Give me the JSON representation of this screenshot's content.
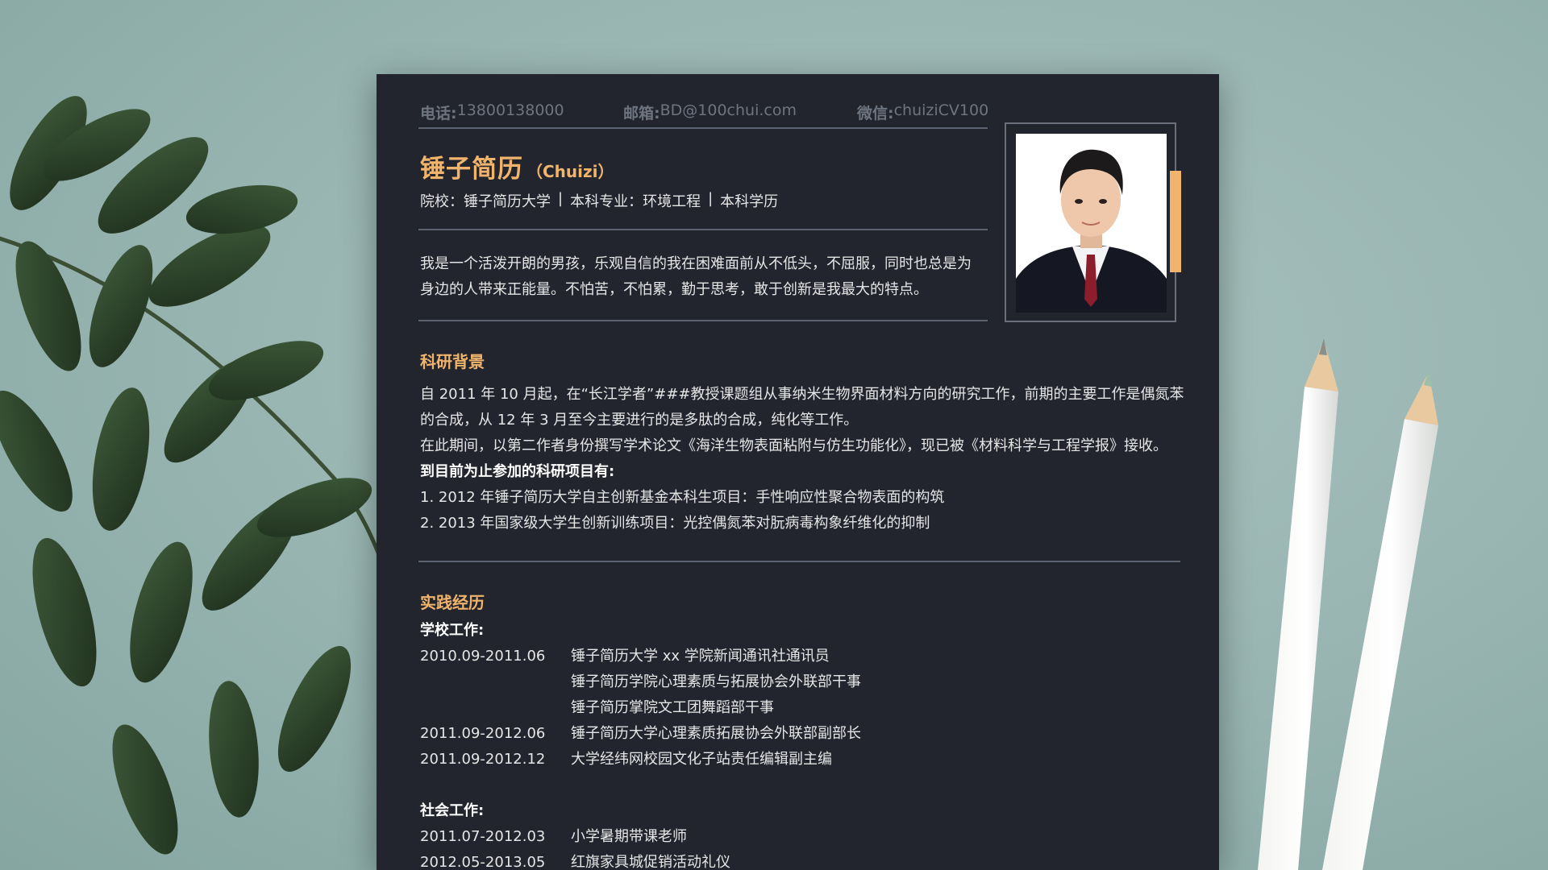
{
  "contact": {
    "phone_label": "电话:",
    "phone": "13800138000",
    "email_label": "邮箱:",
    "email": "BD@100chui.com",
    "wechat_label": "微信:",
    "wechat": "chuiziCV100"
  },
  "profile": {
    "name": "锤子简历",
    "name_en": "（Chuizi）",
    "school": "院校：锤子简历大学",
    "major": "本科专业：环境工程",
    "degree": "本科学历",
    "separator": "|",
    "intro": "我是一个活泼开朗的男孩，乐观自信的我在困难面前从不低头，不屈服，同时也总是为身边的人带来正能量。不怕苦，不怕累，勤于思考，敢于创新是我最大的特点。"
  },
  "research": {
    "title": "科研背景",
    "para1": "自 2011 年 10 月起，在“长江学者”###教授课题组从事纳米生物界面材料方向的研究工作，前期的主要工作是偶氮苯的合成，从 12 年 3 月至今主要进行的是多肽的合成，纯化等工作。",
    "para2": "在此期间，以第二作者身份撰写学术论文《海洋生物表面粘附与仿生功能化》，现已被《材料科学与工程学报》接收。",
    "projects_heading": "到目前为止参加的科研项目有:",
    "projects": [
      "1.  2012 年锤子简历大学自主创新基金本科生项目：手性响应性聚合物表面的构筑",
      "2.  2013 年国家级大学生创新训练项目：光控偶氮苯对朊病毒构象纤维化的抑制"
    ]
  },
  "practice": {
    "title": "实践经历",
    "school_heading": "学校工作:",
    "school_rows": [
      {
        "date": "2010.09-2011.06",
        "desc": "锤子简历大学  xx 学院新闻通讯社通讯员"
      },
      {
        "date": "",
        "desc": "锤子简历学院心理素质与拓展协会外联部干事"
      },
      {
        "date": "",
        "desc": "锤子简历掌院文工团舞蹈部干事"
      },
      {
        "date": "2011.09-2012.06",
        "desc": "锤子简历大学心理素质拓展协会外联部副部长"
      },
      {
        "date": "2011.09-2012.12",
        "desc": "大学经纬网校园文化子站责任编辑副主编"
      }
    ],
    "social_heading": "社会工作:",
    "social_rows": [
      {
        "date": "2011.07-2012.03",
        "desc": "小学暑期带课老师"
      },
      {
        "date": "2012.05-2013.05",
        "desc": "红旗家具城促销活动礼仪"
      }
    ]
  },
  "colors": {
    "accent": "#f0b46d",
    "paper": "#22252d",
    "background": "#9bb7b3"
  }
}
